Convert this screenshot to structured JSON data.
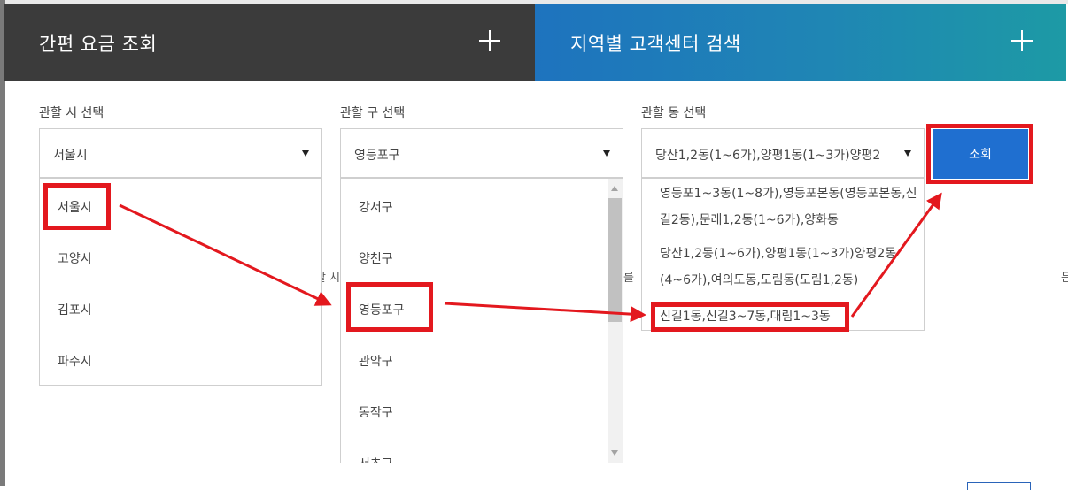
{
  "tabs": {
    "quick_fee": "간편 요금 조회",
    "center_search": "지역별 고객센터 검색"
  },
  "city": {
    "label": "관할 시 선택",
    "selected": "서울시",
    "options": [
      "서울시",
      "고양시",
      "김포시",
      "파주시"
    ]
  },
  "district": {
    "label": "관할 구 선택",
    "selected": "영등포구",
    "options": [
      "강서구",
      "양천구",
      "영등포구",
      "관악구",
      "동작구",
      "서초구"
    ]
  },
  "dong": {
    "label": "관할 동 선택",
    "selected": "당산1,2동(1~6가),양평1동(1~3가)양평2",
    "options": [
      "영등포1~3동(1~8가),영등포본동(영등포본동,신길2동),문래1,2동(1~6가),양화동",
      "당산1,2동(1~6가),양평1동(1~3가)양평2동(4~6가),여의도동,도림동(도림1,2동)",
      "신길1동,신길3~7동,대림1~3동"
    ]
  },
  "submit_label": "조회",
  "bg_fragments": [
    "할 시",
    "를",
    "든"
  ],
  "annotation_color": "#e3181e"
}
